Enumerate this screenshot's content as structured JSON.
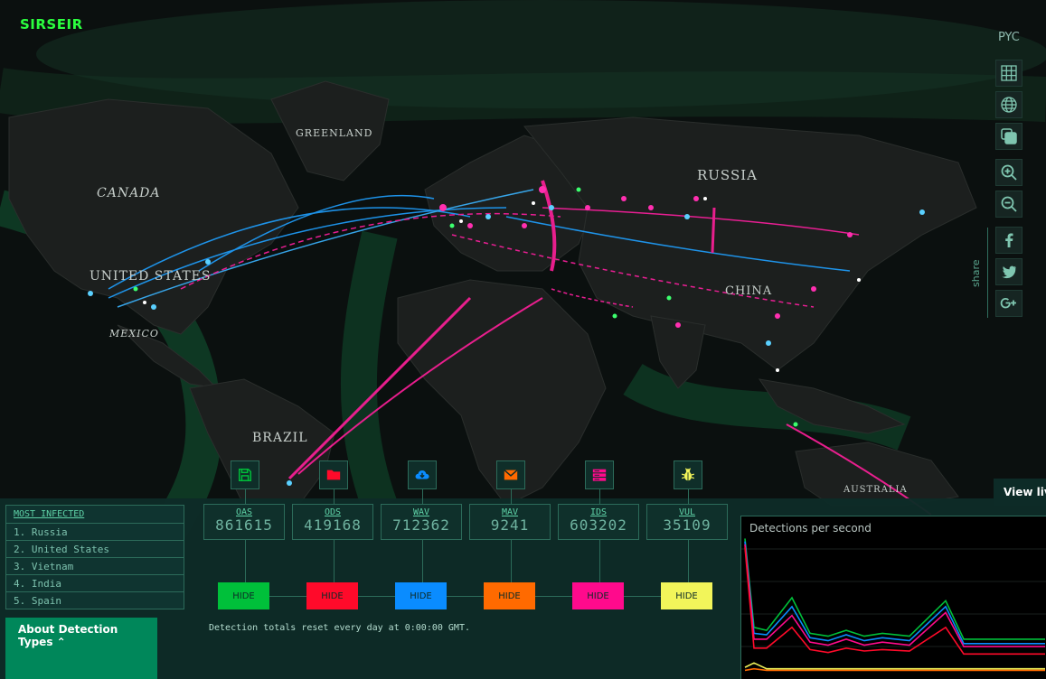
{
  "header": {
    "logo": "SIRSEIR",
    "language": "PYC"
  },
  "toolbar": {
    "items": [
      "grid-icon",
      "globe-icon",
      "layers-icon",
      "zoom-in-icon",
      "zoom-out-icon"
    ],
    "share_label": "share",
    "share_items": [
      "facebook-icon",
      "twitter-icon",
      "google-plus-icon"
    ]
  },
  "map": {
    "labels": [
      "GREENLAND",
      "CANADA",
      "RUSSIA",
      "UNITED STATES",
      "CHINA",
      "MEXICO",
      "BRAZIL",
      "AUSTRALIA"
    ]
  },
  "most_infected": {
    "title": "MOST INFECTED",
    "items": [
      "1. Russia",
      "2. United States",
      "3. Vietnam",
      "4. India",
      "5. Spain"
    ]
  },
  "detections": [
    {
      "code": "OAS",
      "value": "861615",
      "color": "#00c03a",
      "hide": "HIDE",
      "icon": "floppy-disk-icon"
    },
    {
      "code": "ODS",
      "value": "419168",
      "color": "#ff0a2a",
      "hide": "HIDE",
      "icon": "folder-icon"
    },
    {
      "code": "WAV",
      "value": "712362",
      "color": "#0a8cff",
      "hide": "HIDE",
      "icon": "cloud-download-icon"
    },
    {
      "code": "MAV",
      "value": "9241",
      "color": "#ff6a00",
      "hide": "HIDE",
      "icon": "envelope-icon"
    },
    {
      "code": "IDS",
      "value": "603202",
      "color": "#ff0a8c",
      "hide": "HIDE",
      "icon": "server-icon"
    },
    {
      "code": "VUL",
      "value": "35109",
      "color": "#f2f55a",
      "hide": "HIDE",
      "icon": "bug-icon"
    }
  ],
  "about": {
    "label": "About Detection Types ⌃"
  },
  "note": "Detection totals reset every day at 0:00:00 GMT.",
  "graph": {
    "title": "Detections per second",
    "chart_data": {
      "type": "line",
      "title": "Detections per second",
      "series": [
        {
          "name": "OAS",
          "color": "#00c03a",
          "values": [
            90,
            30,
            28,
            50,
            26,
            24,
            28,
            24,
            26,
            24,
            48,
            22,
            22,
            22,
            22
          ]
        },
        {
          "name": "WAV",
          "color": "#0a8cff",
          "values": [
            88,
            26,
            25,
            44,
            23,
            21,
            25,
            21,
            23,
            21,
            44,
            19,
            19,
            19,
            19
          ]
        },
        {
          "name": "IDS",
          "color": "#ff0a8c",
          "values": [
            86,
            22,
            22,
            38,
            20,
            18,
            22,
            18,
            20,
            18,
            40,
            17,
            17,
            17,
            17
          ]
        },
        {
          "name": "ODS",
          "color": "#ff0a2a",
          "values": [
            84,
            16,
            16,
            30,
            15,
            13,
            16,
            14,
            15,
            14,
            30,
            12,
            12,
            12,
            12
          ]
        },
        {
          "name": "VUL",
          "color": "#f2f55a",
          "values": [
            3,
            6,
            2,
            2,
            2,
            2,
            2,
            2,
            2,
            2,
            2,
            2,
            2,
            2,
            2
          ]
        },
        {
          "name": "MAV",
          "color": "#ff6a00",
          "values": [
            1,
            2,
            1,
            1,
            1,
            1,
            1,
            1,
            1,
            1,
            1,
            1,
            1,
            1,
            1
          ]
        }
      ]
    }
  },
  "view_live": "View live"
}
